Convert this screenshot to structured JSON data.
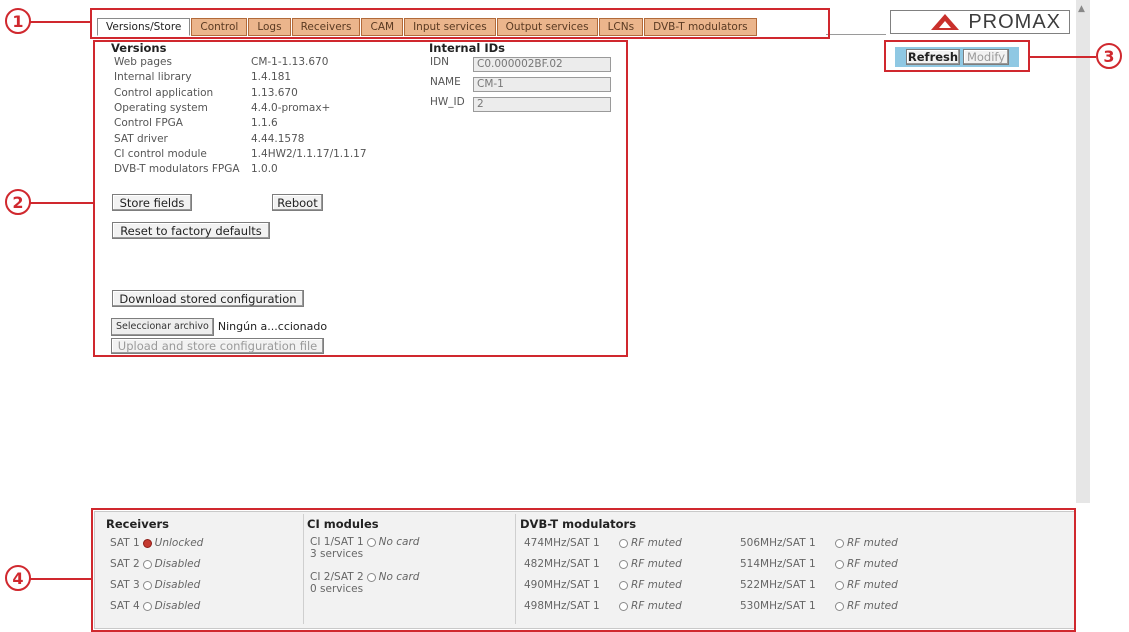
{
  "tabs": [
    {
      "label": "Versions/Store",
      "active": true
    },
    {
      "label": "Control",
      "active": false
    },
    {
      "label": "Logs",
      "active": false
    },
    {
      "label": "Receivers",
      "active": false
    },
    {
      "label": "CAM",
      "active": false
    },
    {
      "label": "Input services",
      "active": false
    },
    {
      "label": "Output services",
      "active": false
    },
    {
      "label": "LCNs",
      "active": false
    },
    {
      "label": "DVB-T modulators",
      "active": false
    }
  ],
  "brand": {
    "name": "PROMAX",
    "accent": "#c9302c"
  },
  "header_buttons": {
    "refresh": "Refresh",
    "modify": "Modify"
  },
  "versions": {
    "title": "Versions",
    "rows": [
      {
        "label": "Web pages",
        "value": "CM-1-1.13.670"
      },
      {
        "label": "Internal library",
        "value": "1.4.181"
      },
      {
        "label": "Control application",
        "value": "1.13.670"
      },
      {
        "label": "Operating system",
        "value": "4.4.0-promax+"
      },
      {
        "label": "Control FPGA",
        "value": "1.1.6"
      },
      {
        "label": "SAT driver",
        "value": "4.44.1578"
      },
      {
        "label": "CI control module",
        "value": "1.4HW2/1.1.17/1.1.17"
      },
      {
        "label": "DVB-T modulators FPGA",
        "value": "1.0.0"
      }
    ]
  },
  "internal_ids": {
    "title": "Internal IDs",
    "rows": [
      {
        "label": "IDN",
        "value": "C0.000002BF.02"
      },
      {
        "label": "NAME",
        "value": "CM-1"
      },
      {
        "label": "HW_ID",
        "value": "2"
      }
    ]
  },
  "actions": {
    "store_fields": "Store fields",
    "reboot": "Reboot",
    "reset_factory": "Reset to factory defaults",
    "download_config": "Download stored configuration",
    "choose_file": "Seleccionar archivo",
    "file_name": "Ningún a...ccionado",
    "upload_config": "Upload and store configuration file"
  },
  "callouts": [
    "1",
    "2",
    "3",
    "4"
  ],
  "status": {
    "receivers": {
      "title": "Receivers",
      "items": [
        {
          "label": "SAT 1",
          "state": "Unlocked",
          "indicator": "red"
        },
        {
          "label": "SAT 2",
          "state": "Disabled",
          "indicator": "off"
        },
        {
          "label": "SAT 3",
          "state": "Disabled",
          "indicator": "off"
        },
        {
          "label": "SAT 4",
          "state": "Disabled",
          "indicator": "off"
        }
      ]
    },
    "ci_modules": {
      "title": "CI modules",
      "items": [
        {
          "label": "CI 1/SAT 1",
          "state": "No card",
          "detail": "3 services"
        },
        {
          "label": "CI 2/SAT 2",
          "state": "No card",
          "detail": "0 services"
        }
      ]
    },
    "dvbt": {
      "title": "DVB-T modulators",
      "items": [
        {
          "label": "474MHz/SAT 1",
          "state": "RF muted"
        },
        {
          "label": "482MHz/SAT 1",
          "state": "RF muted"
        },
        {
          "label": "490MHz/SAT 1",
          "state": "RF muted"
        },
        {
          "label": "498MHz/SAT 1",
          "state": "RF muted"
        },
        {
          "label": "506MHz/SAT 1",
          "state": "RF muted"
        },
        {
          "label": "514MHz/SAT 1",
          "state": "RF muted"
        },
        {
          "label": "522MHz/SAT 1",
          "state": "RF muted"
        },
        {
          "label": "530MHz/SAT 1",
          "state": "RF muted"
        }
      ]
    }
  }
}
